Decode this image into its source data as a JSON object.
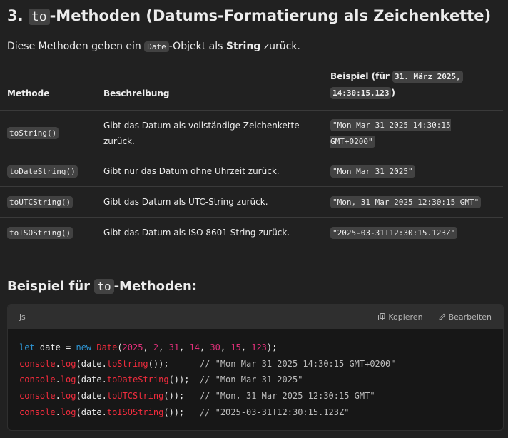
{
  "heading": {
    "prefix": "3. ",
    "code": "to",
    "suffix": "-Methoden (Datums-Formatierung als Zeichenkette)"
  },
  "intro": {
    "before": "Diese Methoden geben ein ",
    "code": "Date",
    "middle": "-Objekt als ",
    "bold": "String",
    "after": " zurück."
  },
  "table": {
    "headers": {
      "method": "Methode",
      "description": "Beschreibung",
      "example_prefix": "Beispiel (für ",
      "example_code_a": "31. März 2025,",
      "example_code_b": "14:30:15.123",
      "example_suffix": ")"
    },
    "rows": [
      {
        "method": "toString()",
        "description": "Gibt das Datum als vollständige Zeichenkette zurück.",
        "example": "\"Mon Mar 31 2025 14:30:15 GMT+0200\""
      },
      {
        "method": "toDateString()",
        "description": "Gibt nur das Datum ohne Uhrzeit zurück.",
        "example": "\"Mon Mar 31 2025\""
      },
      {
        "method": "toUTCString()",
        "description": "Gibt das Datum als UTC-String zurück.",
        "example": "\"Mon, 31 Mar 2025 12:30:15 GMT\""
      },
      {
        "method": "toISOString()",
        "description": "Gibt das Datum als ISO 8601 String zurück.",
        "example": "\"2025-03-31T12:30:15.123Z\""
      }
    ]
  },
  "section2": {
    "prefix": "Beispiel für ",
    "code": "to",
    "suffix": "-Methoden:"
  },
  "codeblock": {
    "language": "js",
    "copy_label": "Kopieren",
    "edit_label": "Bearbeiten",
    "line1": {
      "kw": "let",
      "var": " date = ",
      "new": "new",
      "cls": "Date",
      "open": "(",
      "n1": "2025",
      "n2": "2",
      "n3": "31",
      "n4": "14",
      "n5": "30",
      "n6": "15",
      "n7": "123",
      "sep": ", ",
      "close": ");"
    },
    "lines": [
      {
        "obj": "console",
        "dot": ".",
        "log": "log",
        "arg": "(date.",
        "fn": "toString",
        "end": "());",
        "pad": "      ",
        "comment": "// \"Mon Mar 31 2025 14:30:15 GMT+0200\""
      },
      {
        "obj": "console",
        "dot": ".",
        "log": "log",
        "arg": "(date.",
        "fn": "toDateString",
        "end": "());",
        "pad": "  ",
        "comment": "// \"Mon Mar 31 2025\""
      },
      {
        "obj": "console",
        "dot": ".",
        "log": "log",
        "arg": "(date.",
        "fn": "toUTCString",
        "end": "());",
        "pad": "   ",
        "comment": "// \"Mon, 31 Mar 2025 12:30:15 GMT\""
      },
      {
        "obj": "console",
        "dot": ".",
        "log": "log",
        "arg": "(date.",
        "fn": "toISOString",
        "end": "());",
        "pad": "   ",
        "comment": "// \"2025-03-31T12:30:15.123Z\""
      }
    ]
  },
  "colors": {
    "background": "#212121",
    "code_background": "#171717",
    "keyword": "#2e95d3",
    "identifier_red": "#f22c3d",
    "number": "#df3079"
  }
}
